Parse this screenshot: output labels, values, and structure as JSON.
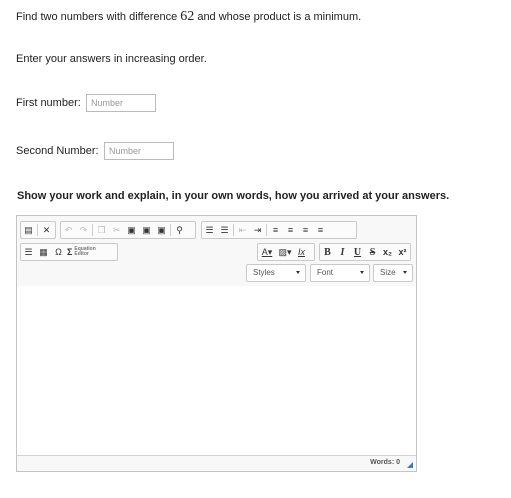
{
  "question": {
    "prefix": "Find two numbers with difference ",
    "number": "62",
    "suffix": " and whose product is a minimum."
  },
  "instruction": "Enter your answers in increasing order.",
  "first": {
    "label": "First number:",
    "placeholder": "Number"
  },
  "second": {
    "label": "Second Number:",
    "placeholder": "Number"
  },
  "work_heading": "Show your work and explain, in your own words, how you arrived at your answers.",
  "editor": {
    "equation_label_line1": "Equation",
    "equation_label_line2": "Editor",
    "styles_label": "Styles",
    "font_label": "Font",
    "size_label": "Size",
    "words_count": "Words: 0",
    "omega": "Ω",
    "sigma": "Σ",
    "bold": "B",
    "italic": "I",
    "underline": "U",
    "strike": "S",
    "subscript": "x₂",
    "superscript": "x²",
    "text_color": "A",
    "remove_format": "Ix"
  },
  "colors": {
    "accent": "#3a7bc8",
    "border": "#c4c4c4"
  }
}
